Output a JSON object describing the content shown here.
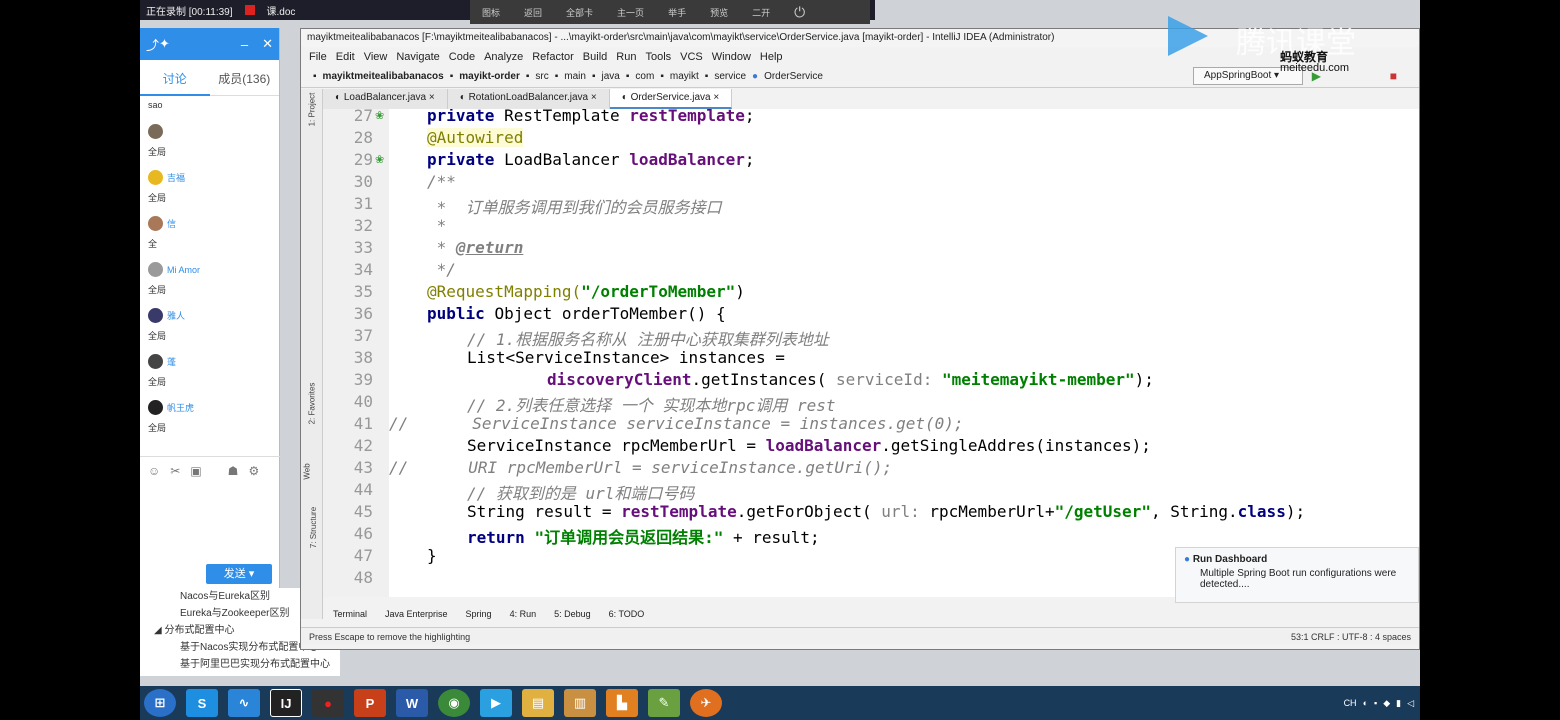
{
  "recording": {
    "status": "正在录制 [00:11:39]",
    "doc": "课.doc"
  },
  "remote_toolbar": [
    "图标",
    "返回",
    "全部卡",
    "主一页",
    "举手",
    "预览",
    "二开"
  ],
  "chat": {
    "tabs": [
      "讨论",
      "成员(136)"
    ],
    "messages": [
      {
        "name": "",
        "text": "sao"
      },
      {
        "name": "",
        "text": "全局"
      },
      {
        "name": "吉福",
        "text": "全局"
      },
      {
        "name": "信",
        "text": "全"
      },
      {
        "name": "Mi Amor",
        "text": "全局"
      },
      {
        "name": "雅人",
        "text": "全局"
      },
      {
        "name": "蓬",
        "text": "全局"
      },
      {
        "name": "帆王虎",
        "text": "全局"
      }
    ],
    "send_label": "发送"
  },
  "tree": [
    "Nacos与Eureka区别",
    "Eureka与Zookeeper区别",
    "分布式配置中心",
    "基于Nacos实现分布式配置中心",
    "基于阿里巴巴实现分布式配置中心"
  ],
  "ide": {
    "title": "mayiktmeitealibabanacos [F:\\mayiktmeitealibabanacos] - ...\\mayikt-order\\src\\main\\java\\com\\mayikt\\service\\OrderService.java [mayikt-order] - IntelliJ IDEA (Administrator)",
    "menu": [
      "File",
      "Edit",
      "View",
      "Navigate",
      "Code",
      "Analyze",
      "Refactor",
      "Build",
      "Run",
      "Tools",
      "VCS",
      "Window",
      "Help"
    ],
    "nav": [
      "mayiktmeitealibabanacos",
      "mayikt-order",
      "src",
      "main",
      "java",
      "com",
      "mayikt",
      "service",
      "OrderService"
    ],
    "run_config": "AppSpringBoot",
    "tabs": [
      "LoadBalancer.java",
      "RotationLoadBalancer.java",
      "OrderService.java"
    ],
    "line_numbers": [
      "27",
      "28",
      "29",
      "30",
      "31",
      "32",
      "33",
      "34",
      "35",
      "36",
      "37",
      "38",
      "39",
      "40",
      "41",
      "42",
      "43",
      "44",
      "45",
      "46",
      "47",
      "48"
    ],
    "code": {
      "l27_a": "private ",
      "l27_b": "RestTemplate ",
      "l27_c": "restTemplate",
      "l28": "@Autowired",
      "l29_a": "private ",
      "l29_b": "LoadBalancer ",
      "l29_c": "loadBalancer",
      "l30": "/**",
      "l31": " *  订单服务调用到我们的会员服务接口",
      "l32": " *",
      "l33_a": " * ",
      "l33_b": "@return",
      "l34": " */",
      "l35_a": "@RequestMapping(",
      "l35_b": "\"/orderToMember\"",
      "l35_c": ")",
      "l36_a": "public ",
      "l36_b": "Object orderToMember() {",
      "l37": "// 1.根据服务名称从 注册中心获取集群列表地址",
      "l38": "List<ServiceInstance> instances =",
      "l39_a": "discoveryClient",
      "l39_b": ".getInstances( ",
      "l39_c": "serviceId: ",
      "l39_d": "\"meitemayikt-member\"",
      "l39_e": ");",
      "l40": "// 2.列表任意选择 一个 实现本地rpc调用 rest",
      "l41_a": "//",
      "l41_b": "ServiceInstance serviceInstance = instances.get(0);",
      "l42_a": "ServiceInstance rpcMemberUrl = ",
      "l42_b": "loadBalancer",
      "l42_c": ".getSingleAddres(instances);",
      "l43_a": "//",
      "l43_b": "URI rpcMemberUrl = serviceInstance.getUri();",
      "l44": "// 获取到的是 url和端口号码",
      "l45_a": "String result = ",
      "l45_b": "restTemplate",
      "l45_c": ".getForObject( ",
      "l45_d": "url: ",
      "l45_e": "rpcMemberUrl+",
      "l45_f": "\"/getUser\"",
      "l45_g": ", String.",
      "l45_h": "class",
      "l45_i": ");",
      "l46_a": "return ",
      "l46_b": "\"订单调用会员返回结果:\"",
      "l46_c": " + result;",
      "l47": "}"
    },
    "bottom_tabs": [
      "Terminal",
      "Java Enterprise",
      "Spring",
      "4: Run",
      "5: Debug",
      "6: TODO"
    ],
    "status_left": "Press Escape to remove the highlighting",
    "status_right": "53:1  CRLF :  UTF-8 :  4 spaces",
    "notification": {
      "title": "Run Dashboard",
      "body": "Multiple Spring Boot run configurations were detected...."
    }
  },
  "brand": {
    "name": "腾讯课堂",
    "sub": "蚂蚁教育",
    "url": "meiteedu.com"
  },
  "tray": {
    "lang": "CH"
  }
}
